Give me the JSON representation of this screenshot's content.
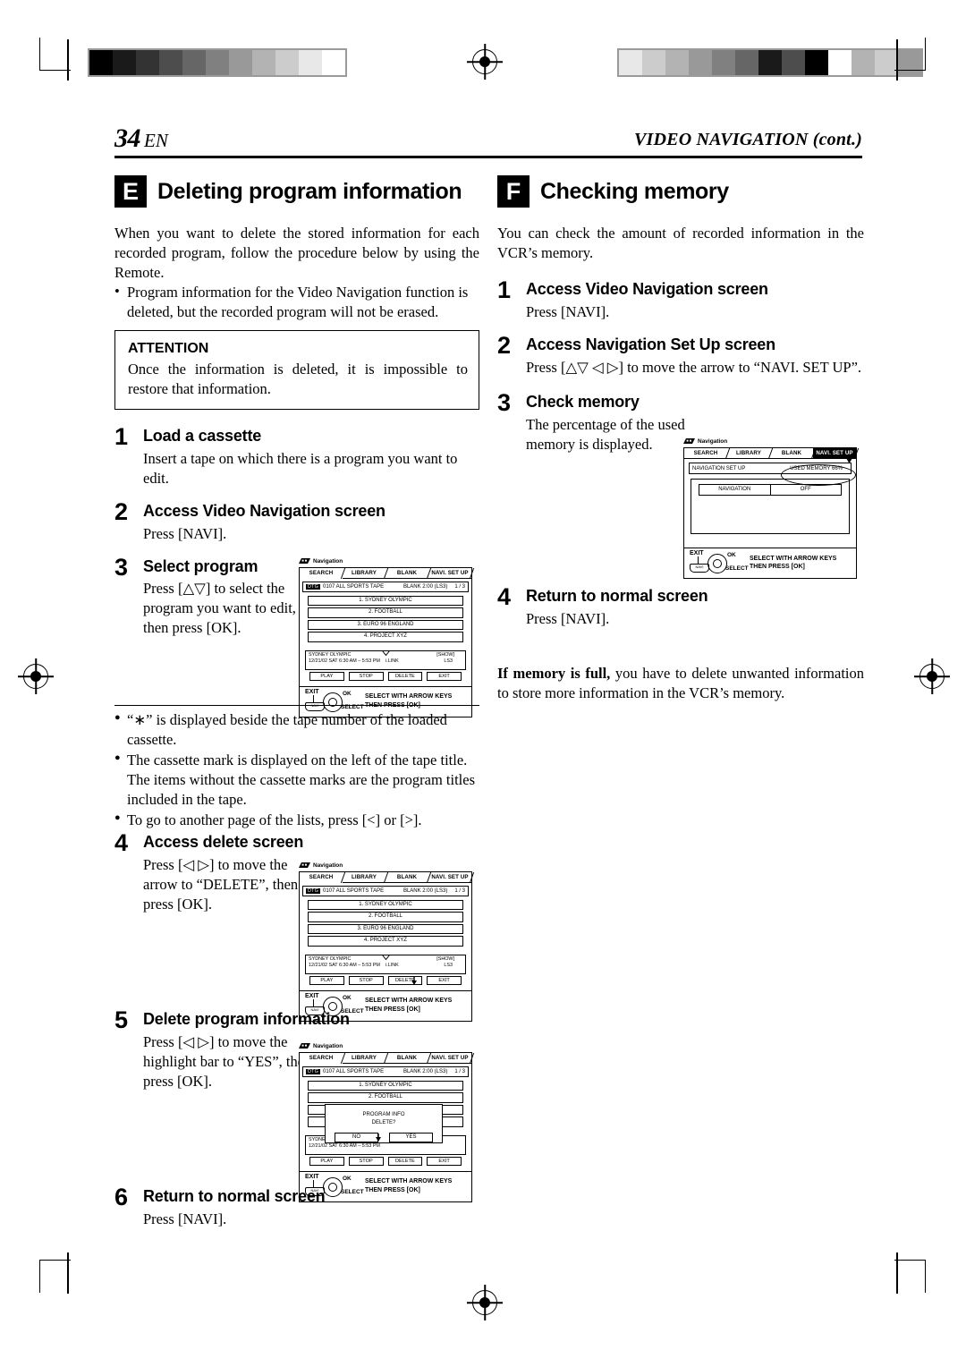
{
  "header": {
    "page_number": "34",
    "page_lang": "EN",
    "running_title": "VIDEO NAVIGATION (cont.)"
  },
  "sections": [
    {
      "letter": "E",
      "title": "Deleting program information"
    },
    {
      "letter": "F",
      "title": "Checking memory"
    }
  ],
  "left": {
    "intro": "When you want to delete the stored information for each recorded program, follow the procedure below by using the Remote.",
    "intro_bullets": [
      "Program information for the Video Navigation function is deleted, but the recorded program will not be erased."
    ],
    "attention": {
      "label": "ATTENTION",
      "text": "Once the information is deleted, it is impossible to restore that information."
    },
    "steps": [
      {
        "n": "1",
        "heading": "Load a cassette",
        "body": "Insert a tape on which there is a program you want to edit."
      },
      {
        "n": "2",
        "heading": "Access Video Navigation screen",
        "body": "Press [NAVI]."
      },
      {
        "n": "3",
        "heading": "Select program",
        "body": "Press [△▽] to select the program you want to edit, then press [OK]."
      },
      {
        "n": "4",
        "heading": "Access delete screen",
        "body": "Press [◁ ▷] to move the arrow to “DELETE”, then press [OK]."
      },
      {
        "n": "5",
        "heading": "Delete program information",
        "body": "Press [◁ ▷] to move the highlight bar to “YES”, then press [OK]."
      },
      {
        "n": "6",
        "heading": "Return to normal screen",
        "body": "Press [NAVI]."
      }
    ],
    "notes": [
      "“∗” is displayed beside the tape number of the loaded cassette.",
      "The cassette mark is displayed on the left of the tape title. The items without the cassette marks are the program titles included in the tape.",
      "To go to another page of the lists, press [<] or [>]."
    ]
  },
  "right": {
    "intro": "You can check the amount of recorded information in the VCR’s memory.",
    "steps": [
      {
        "n": "1",
        "heading": "Access Video Navigation screen",
        "body": "Press [NAVI]."
      },
      {
        "n": "2",
        "heading": "Access Navigation Set Up screen",
        "body": "Press [△▽ ◁ ▷] to move the arrow to “NAVI. SET UP”."
      },
      {
        "n": "3",
        "heading": "Check memory",
        "body": "The percentage of the used memory is displayed."
      },
      {
        "n": "4",
        "heading": "Return to normal screen",
        "body": "Press [NAVI]."
      }
    ],
    "closing_bold": "If memory is full,",
    "closing_rest": " you have to delete unwanted information to store more information in the VCR’s memory."
  },
  "osd": {
    "label": "Navigation",
    "tabs": [
      "SEARCH",
      "LIBRARY",
      "BLANK",
      "NAVI. SET UP"
    ],
    "tape_tag": "DTG",
    "tape_title": "0107 ALL SPORTS TAPE",
    "tape_blank": "BLANK 2:00 (LS3)",
    "page_indicator": "1 / 3",
    "programs": [
      "1. SYDNEY OLYMPIC",
      "2. FOOTBALL",
      "3. EURO 96 ENGLAND",
      "4. PROJECT XYZ"
    ],
    "detail": {
      "title": "SYDNEY OLYMPIC",
      "datetime": "12/21/02 SAT  6:30 AM – 5:53 PM",
      "link": "i.LINK",
      "show": "[SHOW]",
      "speed": "LS3"
    },
    "buttons": [
      "PLAY",
      "STOP",
      "DELETE",
      "EXIT"
    ],
    "footer": {
      "exit": "EXIT",
      "remote_key": "NAVI",
      "ok": "OK",
      "select": "SELECT",
      "msg_line1": "SELECT WITH ARROW KEYS",
      "msg_line2": "THEN PRESS [OK]"
    },
    "dialog": {
      "line1": "PROGRAM INFO",
      "line2": "DELETE?",
      "no": "NO",
      "yes": "YES"
    },
    "setup": {
      "title": "NAVIGATION SET UP",
      "used_memory": "USED MEMORY  66%",
      "row_label": "NAVIGATION",
      "row_value": "OFF"
    }
  },
  "calibration": {
    "gray_steps": [
      "#000000",
      "#1a1a1a",
      "#333333",
      "#4d4d4d",
      "#666666",
      "#808080",
      "#999999",
      "#b3b3b3",
      "#cccccc",
      "#e8e8e8",
      "#ffffff"
    ]
  }
}
